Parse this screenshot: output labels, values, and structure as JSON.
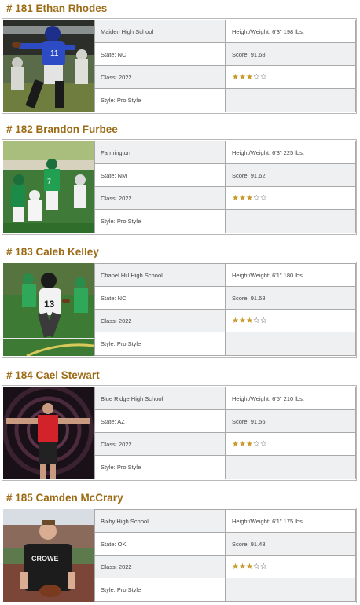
{
  "colors": {
    "name_color": "#9c6b16",
    "star_filled": "#c79a2b",
    "star_empty": "#555555",
    "shaded_cell": "#eef0f2",
    "border": "#a9a9a9"
  },
  "players": [
    {
      "name": "# 181 Ethan Rhodes",
      "photo_icon": "player-photo-qb-blue-jersey",
      "school": "Maiden High School",
      "height_weight": "Height/Weight: 6'3\"  198 lbs.",
      "state": "State: NC",
      "score": "Score: 91.68",
      "class": "Class: 2022",
      "rating_stars": 3,
      "max_stars": 5,
      "style": "Style: Pro Style"
    },
    {
      "name": "# 182 Brandon Furbee",
      "photo_icon": "player-photo-green-jersey-action",
      "school": "Farmington",
      "height_weight": "Height/Weight: 6'3\"  225 lbs.",
      "state": "State: NM",
      "score": "Score: 91.62",
      "class": "Class: 2022",
      "rating_stars": 3,
      "max_stars": 5,
      "style": "Style: Pro Style"
    },
    {
      "name": "# 183 Caleb Kelley",
      "photo_icon": "player-photo-white-jersey-running",
      "school": "Chapel Hill High School",
      "height_weight": "Height/Weight: 6'1\"  180 lbs.",
      "state": "State: NC",
      "score": "Score: 91.58",
      "class": "Class: 2022",
      "rating_stars": 3,
      "max_stars": 5,
      "style": "Style: Pro Style"
    },
    {
      "name": "# 184 Cael Stewart",
      "photo_icon": "player-photo-red-shirt-arms-out",
      "school": "Blue Ridge High School",
      "height_weight": "Height/Weight: 6'5\"  210 lbs.",
      "state": "State: AZ",
      "score": "Score: 91.56",
      "class": "Class: 2022",
      "rating_stars": 3,
      "max_stars": 5,
      "style": "Style: Pro Style"
    },
    {
      "name": "# 185 Camden McCrary",
      "photo_icon": "player-photo-black-shirt-football",
      "school": "Bixby High School",
      "height_weight": "Height/Weight: 6'1\"  175 lbs.",
      "state": "State: OK",
      "score": "Score: 91.48",
      "class": "Class: 2022",
      "rating_stars": 3,
      "max_stars": 5,
      "style": "Style: Pro Style"
    }
  ]
}
